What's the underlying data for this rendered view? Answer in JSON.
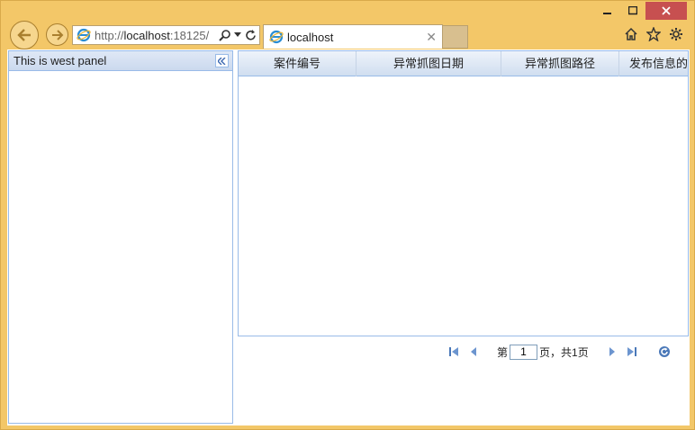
{
  "browser": {
    "address": {
      "scheme_part": "http://",
      "host": "localhost",
      "rest": ":18125/"
    },
    "tab": {
      "title": "localhost"
    },
    "accent_color": "#f3c768",
    "close_color": "#c75050"
  },
  "west_panel": {
    "title": "This is west panel"
  },
  "grid": {
    "columns": [
      {
        "label": "案件编号"
      },
      {
        "label": "异常抓图日期"
      },
      {
        "label": "异常抓图路径"
      },
      {
        "label": "发布信息的单位"
      }
    ],
    "rows": []
  },
  "pager": {
    "prefix": "第",
    "current_page": "1",
    "suffix": "页，共1页"
  },
  "icons": [
    "back-icon",
    "forward-icon",
    "ie-icon",
    "search-icon",
    "dropdown-icon",
    "refresh-icon",
    "close-icon",
    "home-icon",
    "favorites-icon",
    "settings-icon",
    "collapse-icon",
    "first-page-icon",
    "prev-page-icon",
    "next-page-icon",
    "last-page-icon",
    "reload-icon"
  ]
}
